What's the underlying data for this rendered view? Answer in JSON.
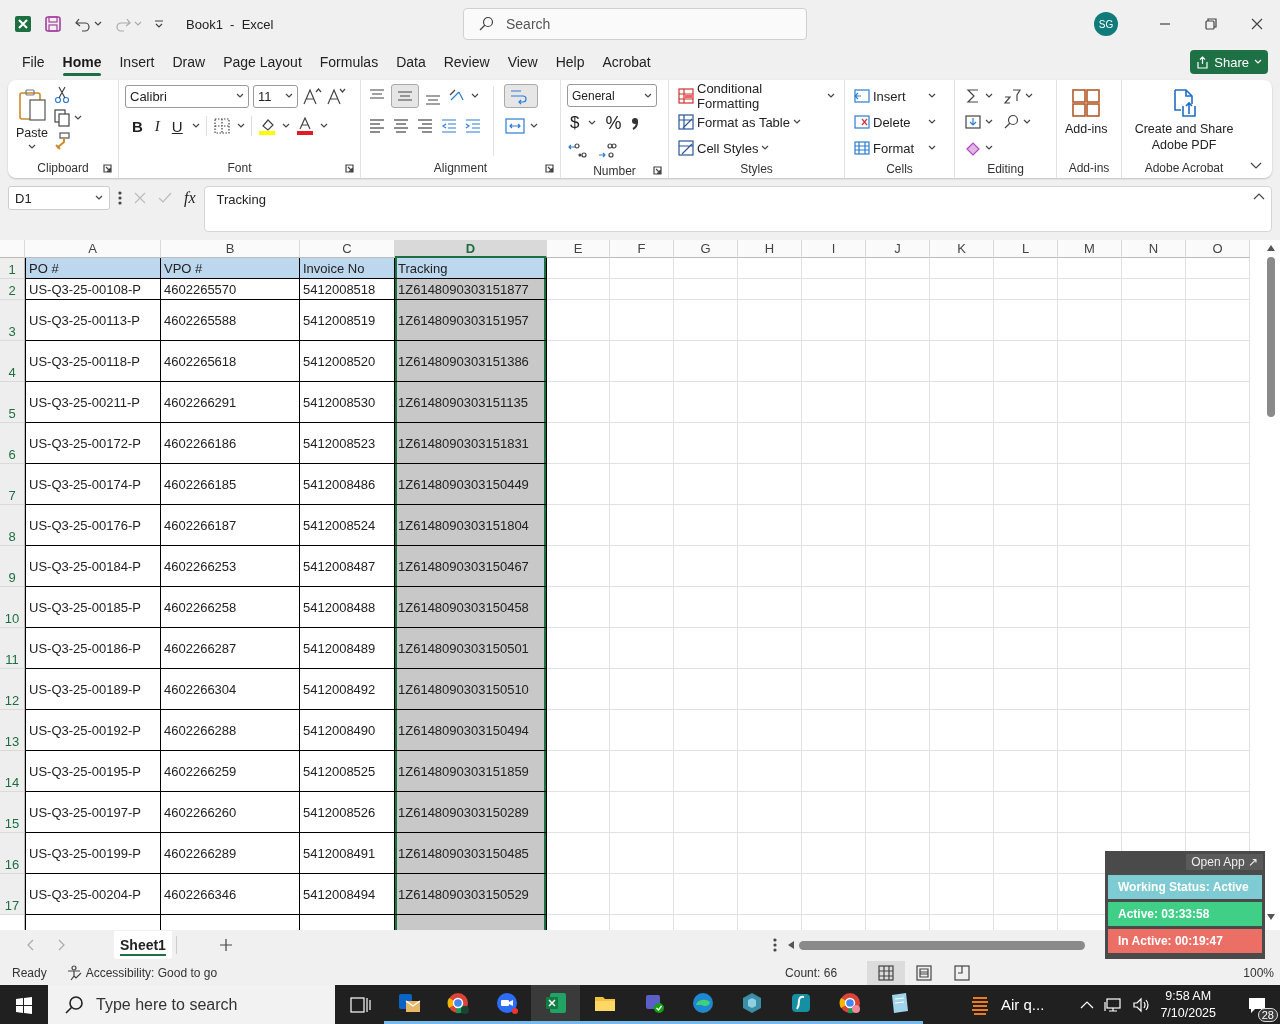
{
  "title_bar": {
    "document_title": "Book1  -  Excel",
    "search_placeholder": "Search",
    "avatar": "SG"
  },
  "menu_tabs": [
    {
      "label": "File",
      "selected": false
    },
    {
      "label": "Home",
      "selected": true
    },
    {
      "label": "Insert",
      "selected": false
    },
    {
      "label": "Draw",
      "selected": false
    },
    {
      "label": "Page Layout",
      "selected": false
    },
    {
      "label": "Formulas",
      "selected": false
    },
    {
      "label": "Data",
      "selected": false
    },
    {
      "label": "Review",
      "selected": false
    },
    {
      "label": "View",
      "selected": false
    },
    {
      "label": "Help",
      "selected": false
    },
    {
      "label": "Acrobat",
      "selected": false
    }
  ],
  "share_button": "Share",
  "ribbon": {
    "clipboard": {
      "paste": "Paste",
      "label": "Clipboard"
    },
    "font": {
      "font_name": "Calibri",
      "font_size": "11",
      "bold": "B",
      "italic": "I",
      "underline": "U",
      "label": "Font"
    },
    "alignment": {
      "middle_align_selected": true,
      "wrap_text_selected": true,
      "label": "Alignment"
    },
    "number": {
      "format": "General",
      "currency": "$",
      "percent": "%",
      "label": "Number"
    },
    "styles": {
      "items": [
        "Conditional Formatting",
        "Format as Table",
        "Cell Styles"
      ],
      "label": "Styles"
    },
    "cells": {
      "items": [
        "Insert",
        "Delete",
        "Format"
      ],
      "label": "Cells"
    },
    "editing": {
      "label": "Editing"
    },
    "add_ins": {
      "button": "Add-ins",
      "label": "Add-ins"
    },
    "adobe_acrobat": {
      "button": "Create and Share Adobe PDF",
      "label": "Adobe Acrobat"
    }
  },
  "formula_bar": {
    "name_box": "D1",
    "fx": "fx",
    "formula": "Tracking"
  },
  "sheet": {
    "columns": [
      {
        "label": "A",
        "selected": false
      },
      {
        "label": "B",
        "selected": false
      },
      {
        "label": "C",
        "selected": false
      },
      {
        "label": "D",
        "selected": true
      },
      {
        "label": "E",
        "selected": false
      },
      {
        "label": "F",
        "selected": false
      },
      {
        "label": "G",
        "selected": false
      },
      {
        "label": "H",
        "selected": false
      },
      {
        "label": "I",
        "selected": false
      },
      {
        "label": "J",
        "selected": false
      },
      {
        "label": "K",
        "selected": false
      },
      {
        "label": "L",
        "selected": false
      },
      {
        "label": "M",
        "selected": false
      },
      {
        "label": "N",
        "selected": false
      },
      {
        "label": "O",
        "selected": false
      }
    ],
    "rows": [
      {
        "number": "1",
        "kind": "header",
        "cells": [
          "PO #",
          "VPO #",
          "Invoice No",
          "Tracking"
        ]
      },
      {
        "number": "2",
        "kind": "data",
        "cells": [
          "US-Q3-25-00108-P",
          "4602265570",
          "5412008518",
          "1Z6148090303151877"
        ]
      },
      {
        "number": "3",
        "kind": "data",
        "cells": [
          "US-Q3-25-00113-P",
          "4602265588",
          "5412008519",
          "1Z6148090303151957"
        ]
      },
      {
        "number": "4",
        "kind": "data",
        "cells": [
          "US-Q3-25-00118-P",
          "4602265618",
          "5412008520",
          "1Z6148090303151386"
        ]
      },
      {
        "number": "5",
        "kind": "data",
        "cells": [
          "US-Q3-25-00211-P",
          "4602266291",
          "5412008530",
          "1Z6148090303151135"
        ]
      },
      {
        "number": "6",
        "kind": "data",
        "cells": [
          "US-Q3-25-00172-P",
          "4602266186",
          "5412008523",
          "1Z6148090303151831"
        ]
      },
      {
        "number": "7",
        "kind": "data",
        "cells": [
          "US-Q3-25-00174-P",
          "4602266185",
          "5412008486",
          "1Z6148090303150449"
        ]
      },
      {
        "number": "8",
        "kind": "data",
        "cells": [
          "US-Q3-25-00176-P",
          "4602266187",
          "5412008524",
          "1Z6148090303151804"
        ]
      },
      {
        "number": "9",
        "kind": "data",
        "cells": [
          "US-Q3-25-00184-P",
          "4602266253",
          "5412008487",
          "1Z6148090303150467"
        ]
      },
      {
        "number": "10",
        "kind": "data",
        "cells": [
          "US-Q3-25-00185-P",
          "4602266258",
          "5412008488",
          "1Z6148090303150458"
        ]
      },
      {
        "number": "11",
        "kind": "data",
        "cells": [
          "US-Q3-25-00186-P",
          "4602266287",
          "5412008489",
          "1Z6148090303150501"
        ]
      },
      {
        "number": "12",
        "kind": "data",
        "cells": [
          "US-Q3-25-00189-P",
          "4602266304",
          "5412008492",
          "1Z6148090303150510"
        ]
      },
      {
        "number": "13",
        "kind": "data",
        "cells": [
          "US-Q3-25-00192-P",
          "4602266288",
          "5412008490",
          "1Z6148090303150494"
        ]
      },
      {
        "number": "14",
        "kind": "data",
        "cells": [
          "US-Q3-25-00195-P",
          "4602266259",
          "5412008525",
          "1Z6148090303151859"
        ]
      },
      {
        "number": "15",
        "kind": "data",
        "cells": [
          "US-Q3-25-00197-P",
          "4602266260",
          "5412008526",
          "1Z6148090303150289"
        ]
      },
      {
        "number": "16",
        "kind": "data",
        "cells": [
          "US-Q3-25-00199-P",
          "4602266289",
          "5412008491",
          "1Z6148090303150485"
        ]
      },
      {
        "number": "17",
        "kind": "data",
        "cells": [
          "US-Q3-25-00204-P",
          "4602266346",
          "5412008494",
          "1Z6148090303150529"
        ]
      }
    ]
  },
  "sheet_tabs": [
    {
      "label": "Sheet1",
      "selected": true
    }
  ],
  "status_bar": {
    "mode": "Ready",
    "accessibility": "Accessibility: Good to go",
    "count": "Count: 66",
    "views": [
      {
        "selected": true
      },
      {
        "selected": false
      },
      {
        "selected": false
      }
    ],
    "zoom": "100%"
  },
  "tracker_widget": {
    "open_app": "Open App ↗",
    "statuses": [
      {
        "text": "Working Status: Active",
        "color": "#7ecbd4"
      },
      {
        "text": "Active: 03:33:58",
        "color": "#3fcf86"
      },
      {
        "text": "In Active: 00:19:47",
        "color": "#ec6f66"
      }
    ]
  },
  "taskbar": {
    "search_placeholder": "Type here to search",
    "apps": [
      {
        "running": true,
        "selected": false
      },
      {
        "running": true,
        "selected": false
      },
      {
        "running": true,
        "selected": false
      },
      {
        "running": true,
        "selected": true
      },
      {
        "running": true,
        "selected": false
      },
      {
        "running": true,
        "selected": false
      },
      {
        "running": true,
        "selected": false
      },
      {
        "running": true,
        "selected": false
      },
      {
        "running": true,
        "selected": false
      },
      {
        "running": true,
        "selected": false
      },
      {
        "running": true,
        "selected": false
      }
    ],
    "weather": "Air q...",
    "time": "9:58 AM",
    "date": "7/10/2025",
    "notifications": "28"
  }
}
